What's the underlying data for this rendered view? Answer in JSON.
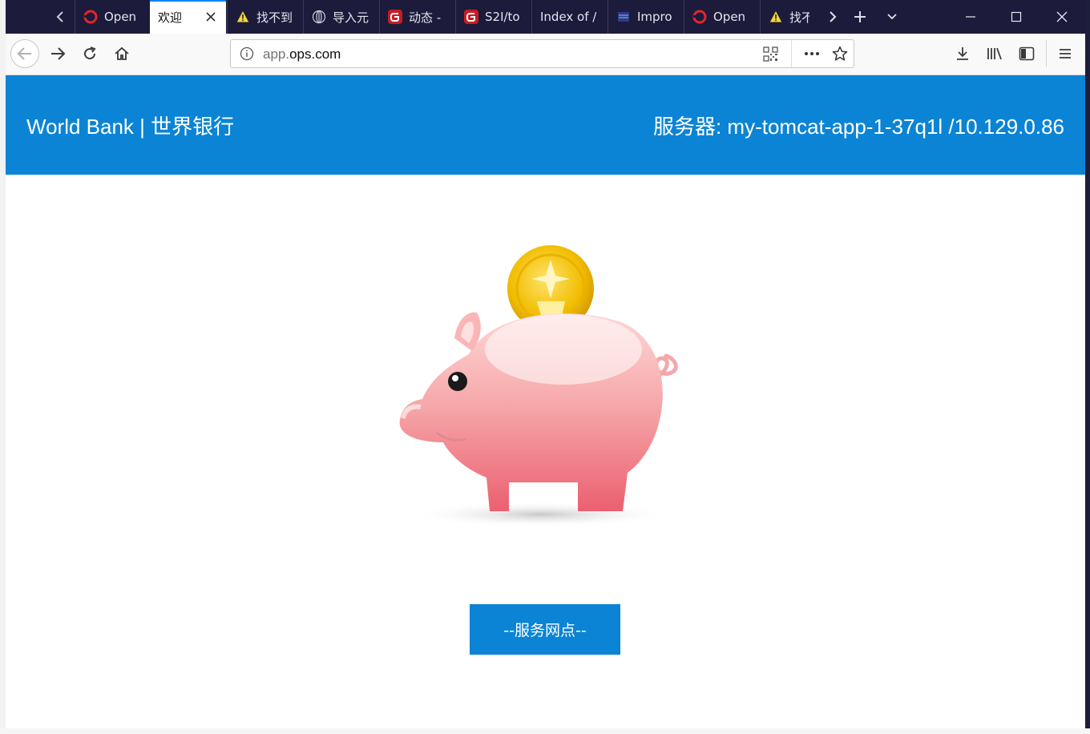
{
  "browser": {
    "tabs": [
      {
        "title": "Open",
        "icon": "openshift-icon",
        "active": false
      },
      {
        "title": "欢迎",
        "icon": "none",
        "active": true
      },
      {
        "title": "找不到",
        "icon": "warning-icon",
        "active": false
      },
      {
        "title": "导入元",
        "icon": "globe-icon",
        "active": false
      },
      {
        "title": "动态 -",
        "icon": "gitee-icon",
        "active": false
      },
      {
        "title": "S2I/to",
        "icon": "gitee-icon",
        "active": false
      },
      {
        "title": "Index of /",
        "icon": "none",
        "active": false
      },
      {
        "title": "Impro",
        "icon": "page-icon",
        "active": false
      },
      {
        "title": "Open",
        "icon": "openshift-icon",
        "active": false
      },
      {
        "title": "找不",
        "icon": "warning-icon",
        "active": false
      }
    ],
    "url_prefix": "app.",
    "url_host": "ops.com"
  },
  "page": {
    "site_title": "World Bank | 世界银行",
    "server_info": "服务器: my-tomcat-app-1-37q1l /10.129.0.86",
    "button_label": "--服务网点--"
  },
  "colors": {
    "header_bg": "#0b84d5",
    "button_bg": "#0b84d5",
    "tabbar_bg": "#1c1b3b"
  }
}
